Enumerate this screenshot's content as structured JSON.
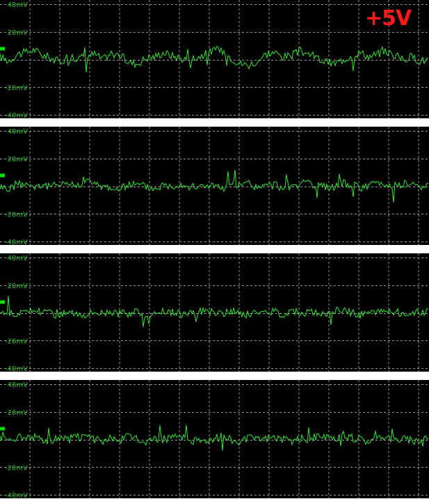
{
  "title": "+5V",
  "colors": {
    "background": "#000000",
    "grid": "#9a9a9a",
    "trace": "#32e632",
    "tick_label": "#2fbf2f",
    "marker": "#00e000",
    "title": "#ff1a1a",
    "separator": "#ffffff"
  },
  "chart_data": [
    {
      "type": "line",
      "title": "",
      "ylabel": "",
      "ylim": [
        -40,
        40
      ],
      "yticks": [
        -40,
        -20,
        0,
        20,
        40
      ],
      "tick_labels": [
        "40mV",
        "20mV",
        "-20mV",
        "-40mV"
      ],
      "xlim": [
        0,
        100
      ],
      "grid": true,
      "series": [
        {
          "x": [
            0,
            2,
            4,
            6,
            8,
            10,
            12,
            14,
            16,
            18,
            20,
            22,
            24,
            26,
            28,
            30,
            32,
            34,
            36,
            38,
            40,
            42,
            44,
            46,
            48,
            50,
            52,
            54,
            56,
            58,
            60,
            62,
            64,
            66,
            68,
            70,
            72,
            74,
            76,
            78,
            80,
            82,
            84,
            86,
            88,
            90,
            92,
            94,
            96,
            98,
            100
          ],
          "y": [
            2,
            -1,
            4,
            5,
            7,
            3,
            1,
            -2,
            3,
            1,
            2,
            4,
            0,
            5,
            3,
            -2,
            -3,
            1,
            2,
            5,
            3,
            1,
            0,
            2,
            4,
            7,
            6,
            1,
            -3,
            -4,
            -1,
            4,
            5,
            2,
            3,
            6,
            4,
            1,
            -2,
            -3,
            0,
            3,
            5,
            2,
            4,
            6,
            3,
            0,
            2,
            -1,
            0
          ]
        }
      ]
    },
    {
      "type": "line",
      "title": "",
      "ylabel": "",
      "ylim": [
        -40,
        40
      ],
      "yticks": [
        -40,
        -20,
        0,
        20,
        40
      ],
      "tick_labels": [
        "40mV",
        "20mV",
        "-20mV",
        "-40mV"
      ],
      "xlim": [
        0,
        100
      ],
      "grid": true,
      "series": [
        {
          "x": [
            0,
            2,
            4,
            6,
            8,
            10,
            12,
            14,
            16,
            18,
            20,
            22,
            24,
            26,
            28,
            30,
            32,
            34,
            36,
            38,
            40,
            42,
            44,
            46,
            48,
            50,
            52,
            54,
            56,
            58,
            60,
            62,
            64,
            66,
            68,
            70,
            72,
            74,
            76,
            78,
            80,
            82,
            84,
            86,
            88,
            90,
            92,
            94,
            96,
            98,
            100
          ],
          "y": [
            0,
            -2,
            1,
            2,
            0,
            1,
            -1,
            3,
            2,
            0,
            5,
            1,
            0,
            -1,
            -3,
            2,
            1,
            0,
            -2,
            1,
            0,
            2,
            0,
            -1,
            1,
            0,
            -2,
            1,
            0,
            2,
            -1,
            0,
            1,
            -1,
            0,
            2,
            1,
            0,
            -1,
            0,
            2,
            1,
            -1,
            0,
            3,
            1,
            0,
            2,
            1,
            0,
            -1
          ]
        }
      ]
    },
    {
      "type": "line",
      "title": "",
      "ylabel": "",
      "ylim": [
        -40,
        40
      ],
      "yticks": [
        -40,
        -20,
        0,
        20,
        40
      ],
      "tick_labels": [
        "40mV",
        "20mV",
        "-20mV",
        "-40mV"
      ],
      "xlim": [
        0,
        100
      ],
      "grid": true,
      "series": [
        {
          "x": [
            0,
            2,
            4,
            6,
            8,
            10,
            12,
            14,
            16,
            18,
            20,
            22,
            24,
            26,
            28,
            30,
            32,
            34,
            36,
            38,
            40,
            42,
            44,
            46,
            48,
            50,
            52,
            54,
            56,
            58,
            60,
            62,
            64,
            66,
            68,
            70,
            72,
            74,
            76,
            78,
            80,
            82,
            84,
            86,
            88,
            90,
            92,
            94,
            96,
            98,
            100
          ],
          "y": [
            1,
            0,
            -1,
            0,
            2,
            1,
            0,
            -2,
            1,
            0,
            -1,
            1,
            0,
            2,
            -1,
            0,
            1,
            -2,
            0,
            1,
            0,
            -1,
            1,
            0,
            2,
            0,
            -1,
            1,
            0,
            -2,
            1,
            0,
            1,
            -1,
            2,
            0,
            1,
            -1,
            0,
            1,
            2,
            0,
            -1,
            1,
            0,
            2,
            1,
            0,
            -1,
            1,
            0
          ]
        }
      ]
    },
    {
      "type": "line",
      "title": "",
      "ylabel": "",
      "ylim": [
        -40,
        40
      ],
      "yticks": [
        -40,
        -20,
        0,
        20,
        40
      ],
      "tick_labels": [
        "40mV",
        "20mV",
        "-20mV",
        "-40mV"
      ],
      "xlim": [
        0,
        100
      ],
      "grid": true,
      "series": [
        {
          "x": [
            0,
            2,
            4,
            6,
            8,
            10,
            12,
            14,
            16,
            18,
            20,
            22,
            24,
            26,
            28,
            30,
            32,
            34,
            36,
            38,
            40,
            42,
            44,
            46,
            48,
            50,
            52,
            54,
            56,
            58,
            60,
            62,
            64,
            66,
            68,
            70,
            72,
            74,
            76,
            78,
            80,
            82,
            84,
            86,
            88,
            90,
            92,
            94,
            96,
            98,
            100
          ],
          "y": [
            2,
            0,
            1,
            3,
            2,
            0,
            -1,
            1,
            0,
            2,
            1,
            0,
            -1,
            1,
            0,
            2,
            0,
            -1,
            1,
            0,
            2,
            1,
            0,
            -1,
            0,
            1,
            2,
            0,
            -2,
            1,
            0,
            1,
            2,
            0,
            -1,
            1,
            0,
            2,
            1,
            0,
            3,
            1,
            0,
            -1,
            1,
            2,
            0,
            1,
            -1,
            0,
            1
          ]
        }
      ]
    }
  ]
}
